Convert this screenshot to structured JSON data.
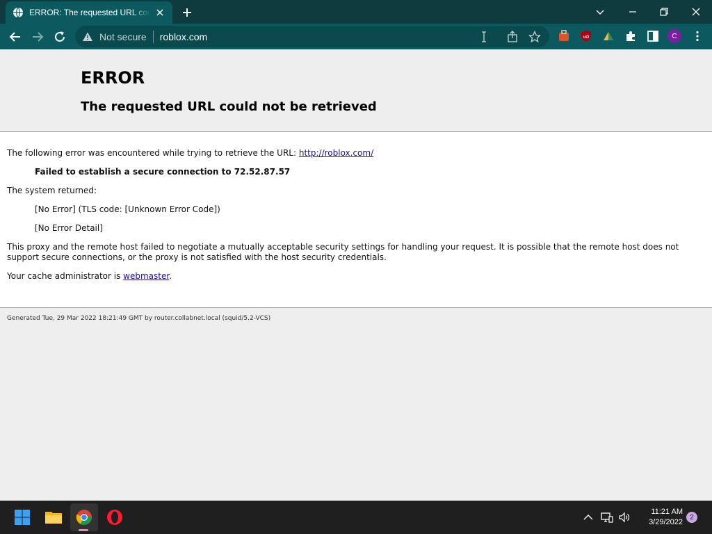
{
  "browser": {
    "tab_title": "ERROR: The requested URL could not be retrieved",
    "omnibox": {
      "security_label": "Not secure",
      "url": "roblox.com"
    },
    "profile_initial": "C",
    "accent": "#0c5a5f"
  },
  "page": {
    "title": "ERROR",
    "subtitle": "The requested URL could not be retrieved",
    "intro": "The following error was encountered while trying to retrieve the URL: ",
    "intro_link": "http://roblox.com/",
    "error_detail": "Failed to establish a secure connection to 72.52.87.57",
    "system_returned": "The system returned:",
    "sys_line1": "[No Error] (TLS code: [Unknown Error Code])",
    "sys_line2": "[No Error Detail]",
    "explanation_1": "This proxy and the remote host failed to negotiate a mutually acceptable security settings for handling your request. It is possible that the remote host does not",
    "explanation_2": "support secure connections, or the proxy is not satisfied with the host security credentials.",
    "admin_prefix": "Your cache administrator is ",
    "admin_link": "webmaster",
    "admin_suffix": ".",
    "footer": "Generated Tue, 29 Mar 2022 18:21:49 GMT by router.collabnet.local (squid/5.2-VCS)"
  },
  "taskbar": {
    "time": "11:21 AM",
    "date": "3/29/2022",
    "notification_count": "2",
    "apps": [
      "windows-start-icon",
      "file-explorer-icon",
      "chrome-icon",
      "opera-icon"
    ]
  }
}
